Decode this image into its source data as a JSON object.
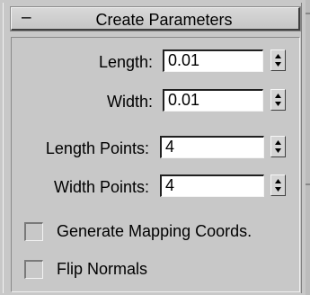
{
  "rollout": {
    "toggle_symbol": "–",
    "title": "Create Parameters"
  },
  "params": [
    {
      "label": "Length:",
      "value": "0.01"
    },
    {
      "label": "Width:",
      "value": "0.01"
    },
    {
      "label": "Length Points:",
      "value": "4"
    },
    {
      "label": "Width Points:",
      "value": "4"
    }
  ],
  "options": [
    {
      "label": "Generate Mapping Coords.",
      "checked": false
    },
    {
      "label": "Flip Normals",
      "checked": false
    }
  ],
  "colors": {
    "panel": "#c8c8c8",
    "field_bg": "#ffffff",
    "dark_edge": "#404040"
  }
}
